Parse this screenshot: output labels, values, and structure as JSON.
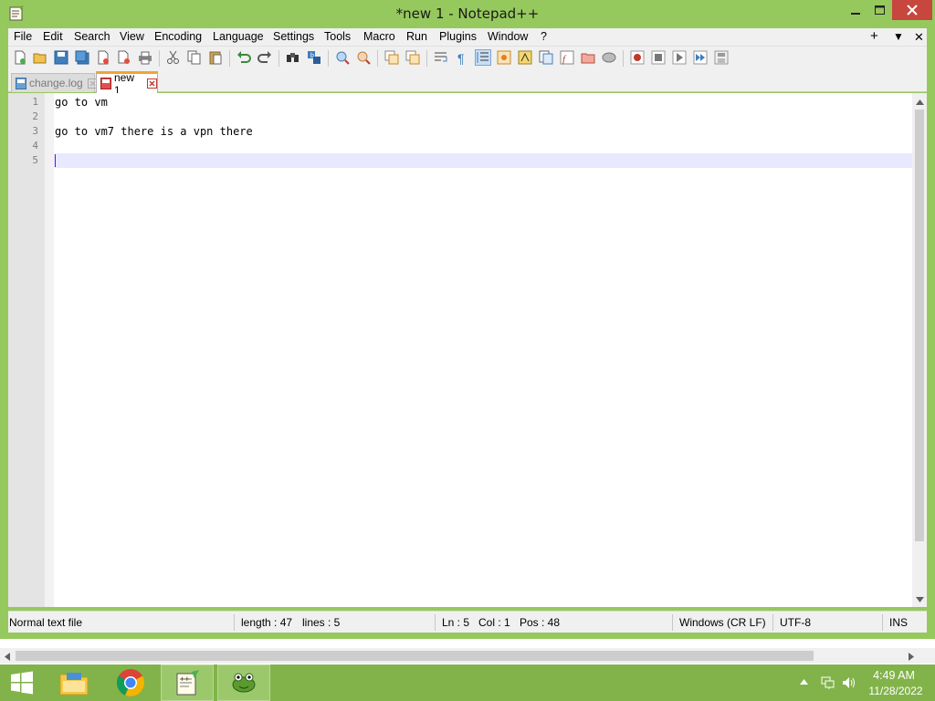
{
  "window": {
    "title": "*new 1 - Notepad++",
    "accent_color": "#96c95d"
  },
  "menu": {
    "items": [
      "File",
      "Edit",
      "Search",
      "View",
      "Encoding",
      "Language",
      "Settings",
      "Tools",
      "Macro",
      "Run",
      "Plugins",
      "Window",
      "?"
    ],
    "right_controls": [
      "+",
      "▼",
      "✕"
    ]
  },
  "toolbar": {
    "icons": [
      "new-file-icon",
      "open-file-icon",
      "save-icon",
      "save-all-icon",
      "close-icon",
      "close-all-icon",
      "print-icon",
      "cut-icon",
      "copy-icon",
      "paste-icon",
      "undo-icon",
      "redo-icon",
      "find-icon",
      "replace-icon",
      "zoom-in-icon",
      "zoom-out-icon",
      "sync-vertical-icon",
      "sync-horizontal-icon",
      "word-wrap-icon",
      "show-all-chars-icon",
      "indent-guide-icon",
      "user-defined-language-icon",
      "document-map-icon",
      "document-list-icon",
      "function-list-icon",
      "folder-as-workspace-icon",
      "monitoring-icon",
      "record-macro-icon",
      "stop-macro-icon",
      "play-macro-icon",
      "run-macro-multiple-icon",
      "save-macro-icon"
    ]
  },
  "tabs": [
    {
      "label": "change.log",
      "active": false
    },
    {
      "label": "new 1",
      "active": true
    }
  ],
  "editor": {
    "line_numbers": [
      "1",
      "2",
      "3",
      "4",
      "5"
    ],
    "lines": [
      "go to vm",
      "",
      "go to vm7 there is a vpn there",
      "",
      ""
    ],
    "current_line": 5
  },
  "status": {
    "file_type": "Normal text file",
    "length": "length : 47",
    "lines": "lines : 5",
    "ln": "Ln : 5",
    "col": "Col : 1",
    "pos": "Pos : 48",
    "eol": "Windows (CR LF)",
    "encoding": "UTF-8",
    "mode": "INS"
  },
  "taskbar": {
    "apps": [
      "File Explorer",
      "Google Chrome",
      "Notepad++",
      "Frog app"
    ],
    "tray_icons": [
      "show-hidden-icons-icon",
      "network-icon",
      "volume-icon"
    ],
    "time": "4:49 AM",
    "date": "11/28/2022"
  }
}
